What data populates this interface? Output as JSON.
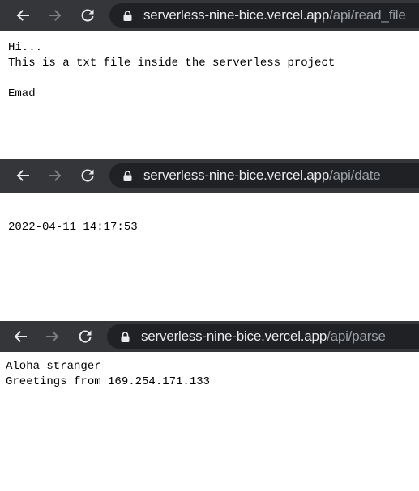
{
  "icons": {
    "back": "back-arrow-icon",
    "forward": "forward-arrow-icon",
    "reload": "reload-icon",
    "lock": "lock-icon"
  },
  "colors": {
    "toolbar_bg": "#35363a",
    "omnibox_bg": "#202124",
    "url_host": "#e8eaed",
    "url_path": "#9aa0a6",
    "back_icon": "#e8eaed",
    "forward_icon_disabled": "#7d7e80"
  },
  "windows": [
    {
      "url_host": "serverless-nine-bice.vercel.app",
      "url_path": "/api/read_file",
      "lines": [
        "Hi...",
        "This is a txt file inside the serverless project",
        "",
        "Emad"
      ]
    },
    {
      "url_host": "serverless-nine-bice.vercel.app",
      "url_path": "/api/date",
      "lines": [
        "2022-04-11 14:17:53"
      ]
    },
    {
      "url_host": "serverless-nine-bice.vercel.app",
      "url_path": "/api/parse",
      "lines": [
        "Aloha stranger",
        "Greetings from 169.254.171.133"
      ]
    }
  ]
}
